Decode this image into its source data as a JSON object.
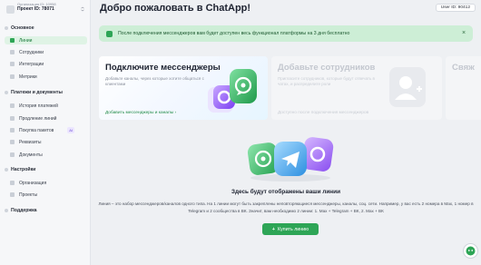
{
  "sidebar": {
    "org_label": "Организация ID: 10958",
    "project": "Проект ID: 78071",
    "sections": [
      {
        "title": "Основное",
        "items": [
          {
            "label": "Линии",
            "active": true
          },
          {
            "label": "Сотрудники"
          },
          {
            "label": "Интеграции"
          },
          {
            "label": "Метрики"
          }
        ]
      },
      {
        "title": "Платежи и документы",
        "items": [
          {
            "label": "История платежей"
          },
          {
            "label": "Продление линий"
          },
          {
            "label": "Покупка пакетов",
            "badge": "AI"
          },
          {
            "label": "Реквизиты"
          },
          {
            "label": "Документы"
          }
        ]
      },
      {
        "title": "Настройки",
        "items": [
          {
            "label": "Организация"
          },
          {
            "label": "Проекты"
          }
        ]
      },
      {
        "title": "Поддержка",
        "items": []
      }
    ]
  },
  "header": {
    "title": "Добро пожаловать в ChatApp!",
    "user_id": "User ID: 90412"
  },
  "banner": {
    "text": "После подключения мессенджеров вам будет доступен весь функционал платформы на 3 дня бесплатно"
  },
  "cards": [
    {
      "title": "Подключите мессенджеры",
      "desc": "Добавьте каналы, через которые хотите общаться с клиентами",
      "link": "Добавить мессенджеры и каналы"
    },
    {
      "title": "Добавьте сотрудников",
      "desc": "Пригласите сотрудников, которые будут отвечать в чатах, и распределите роли",
      "link": "Доступно после подключения мессенджеров"
    },
    {
      "title": "Свяж",
      "desc": "",
      "link": ""
    }
  ],
  "empty_state": {
    "title": "Здесь будут отображены ваши линии",
    "desc": "Линия – это набор мессенджеров/каналов одного типа. На 1 линии могут быть закреплены неповторяющиеся мессенджеры, каналы, соц. сети. Например, у вас есть 2 номера в Max, 1 номер в Telegram и 2 сообщества в ВК. Значит, вам необходимо 2 линии: 1. Max + Telegram + ВК, 2. Max + ВК",
    "button": "Купить линию"
  },
  "colors": {
    "accent": "#2ea556",
    "banner_bg": "#cdeed6",
    "sidebar_active": "#dff3e5"
  }
}
